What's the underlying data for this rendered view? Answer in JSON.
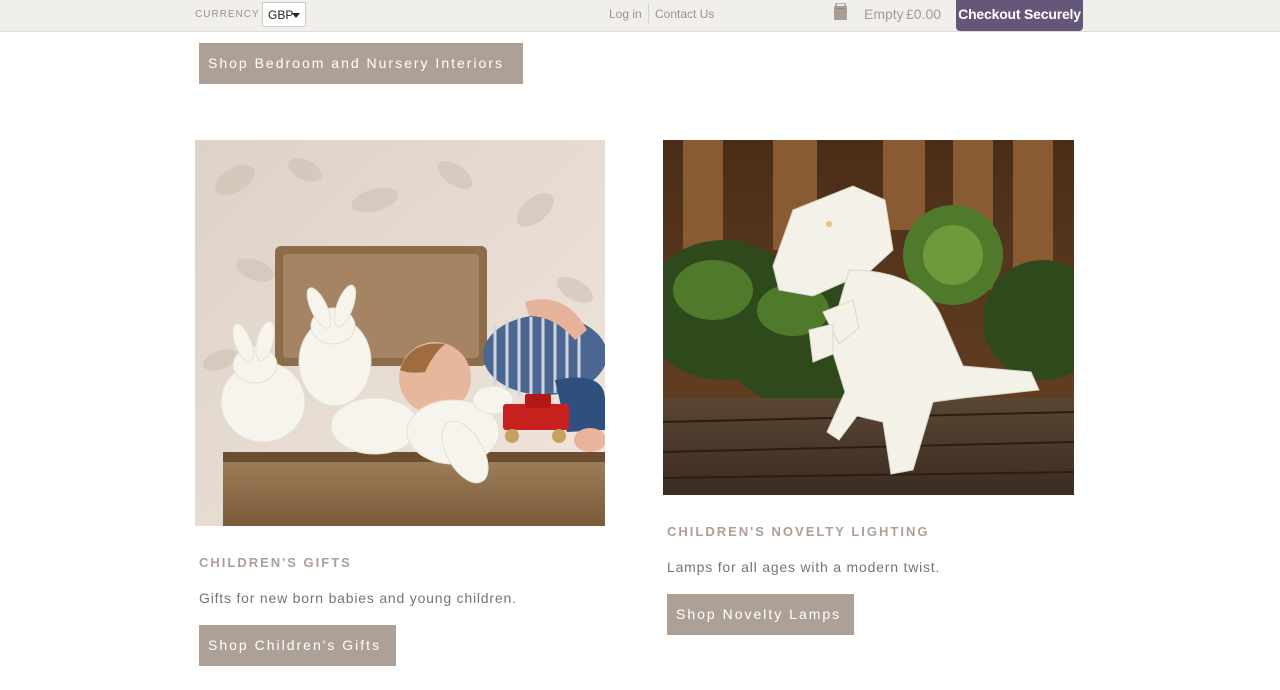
{
  "topbar": {
    "currency_label": "CURRENCY",
    "currency_value": "GBP",
    "login": "Log in",
    "contact": "Contact Us",
    "cart_icon": "shopping-bag-icon",
    "cart_status": "Empty",
    "cart_total": "£0.00",
    "checkout": "Checkout Securely"
  },
  "hero": {
    "shop_bedroom": "Shop Bedroom and Nursery Interiors"
  },
  "products": [
    {
      "title": "CHILDREN'S GIFTS",
      "description": "Gifts for new born babies and young children.",
      "button": "Shop Children's Gifts"
    },
    {
      "title": "CHILDREN'S NOVELTY LIGHTING",
      "description": "Lamps for all ages with a modern twist.",
      "button": "Shop Novelty Lamps"
    }
  ],
  "colors": {
    "checkout_bg": "#66577a",
    "button_bg": "#ada197",
    "topbar_bg": "#f1efeb",
    "title_color": "#ad9f95"
  }
}
